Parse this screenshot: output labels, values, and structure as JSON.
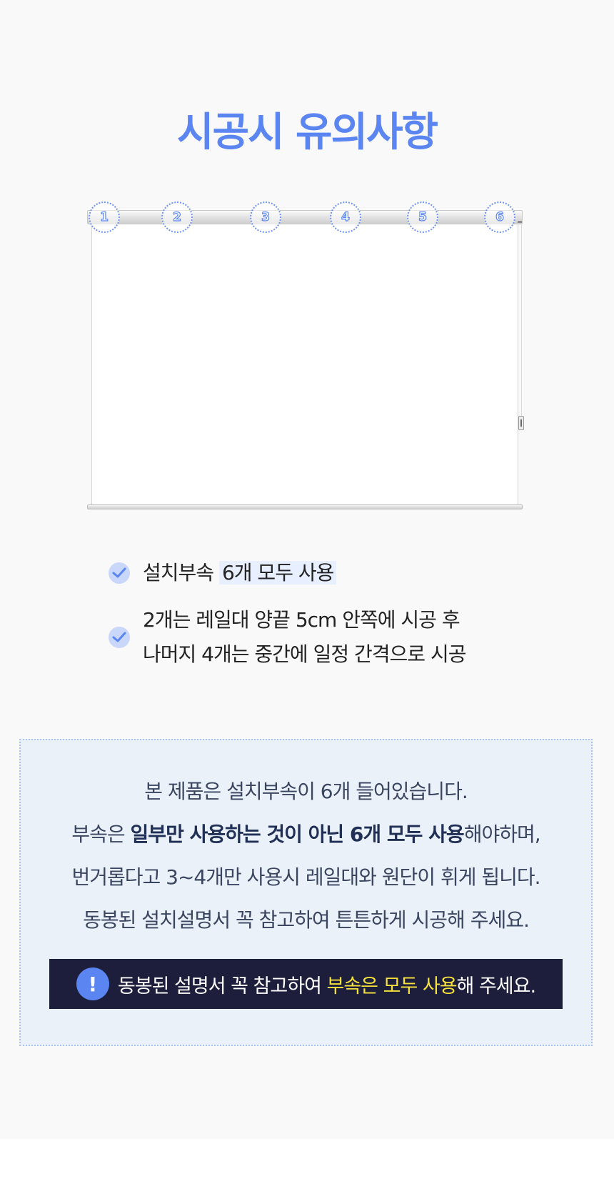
{
  "title": "시공시 유의사항",
  "markers": [
    "1",
    "2",
    "3",
    "4",
    "5",
    "6"
  ],
  "checklist": {
    "item1_prefix": "설치부속 ",
    "item1_highlight": "6개 모두 사용",
    "item2_line1": "2개는 레일대 양끝 5cm 안쪽에 시공 후",
    "item2_line2": "나머지 4개는 중간에 일정 간격으로 시공"
  },
  "notice": {
    "line1": "본 제품은 설치부속이 6개 들어있습니다.",
    "line2_prefix": "부속은 ",
    "line2_bold": "일부만 사용하는 것이 아닌 6개 모두 사용",
    "line2_suffix": "해야하며,",
    "line3": "번거롭다고 3~4개만 사용시 레일대와 원단이 휘게 됩니다.",
    "line4": "동봉된 설치설명서 꼭 참고하여 튼튼하게 시공해 주세요."
  },
  "banner": {
    "icon_glyph": "!",
    "prefix": "동봉된 설명서 꼭 참고하여 ",
    "highlight": "부속은 모두 사용",
    "suffix": "해 주세요."
  },
  "colors": {
    "accent": "#5b86f2",
    "notice_bg": "#ebf1f9",
    "banner_bg": "#1c1e3c",
    "banner_highlight": "#f7e23b"
  },
  "icons": [
    "alert-icon",
    "check-icon"
  ]
}
